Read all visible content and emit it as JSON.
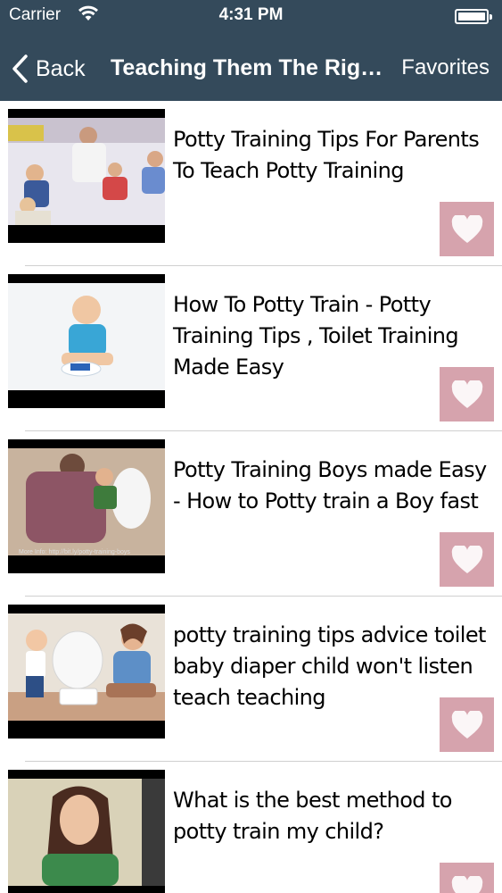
{
  "status_bar": {
    "carrier": "Carrier",
    "time": "4:31 PM"
  },
  "nav_bar": {
    "back_label": "Back",
    "title": "Teaching Them The Right Way",
    "favorites_label": "Favorites"
  },
  "colors": {
    "nav_background": "#344a5b",
    "heart_button": "#d6a3ad",
    "heart_icon": "#ffffff"
  },
  "videos": [
    {
      "title": "Potty Training Tips For Parents To Teach Potty Training",
      "caption": ""
    },
    {
      "title": "How To Potty Train - Potty Training Tips , Toilet Training Made Easy",
      "caption": ""
    },
    {
      "title": "Potty Training Boys made Easy - How to Potty train a Boy fast",
      "caption": "More Info: http://bit.ly/potty-training-boys"
    },
    {
      "title": "potty training tips advice toilet baby diaper child won't listen teach teaching",
      "caption": ""
    },
    {
      "title": "What is the best method to potty train my child?",
      "caption": ""
    }
  ]
}
